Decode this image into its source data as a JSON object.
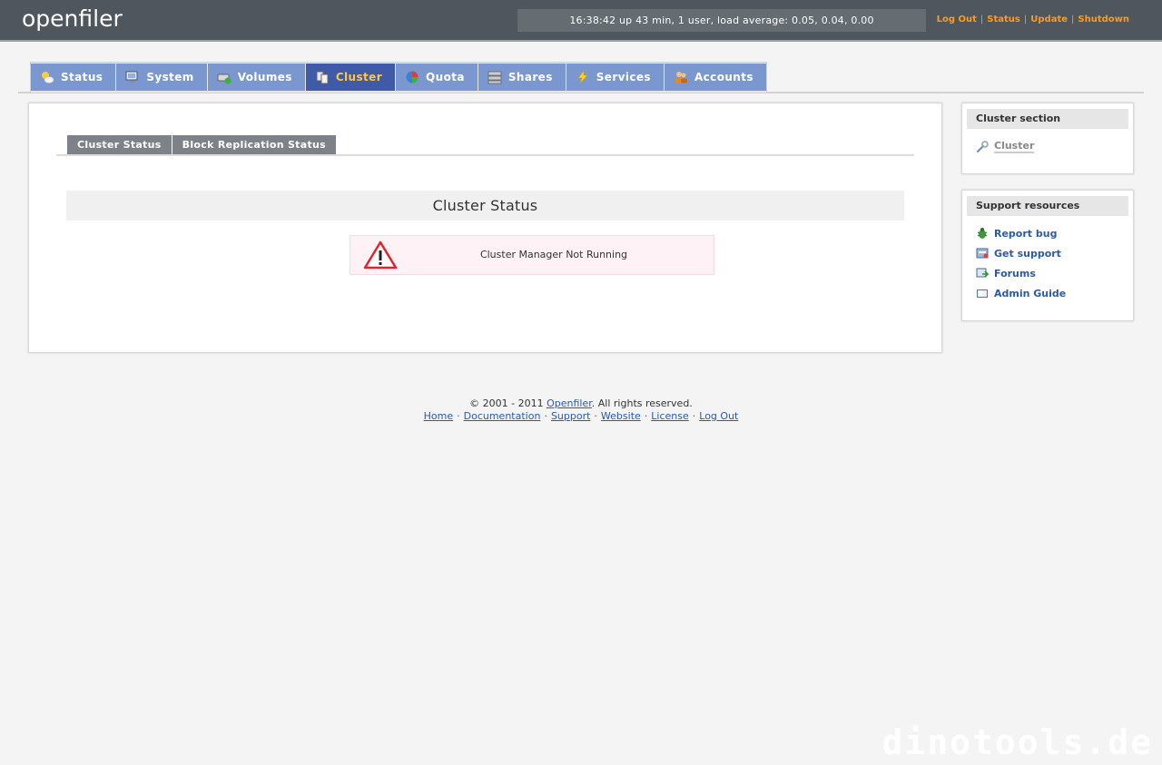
{
  "header": {
    "logo": "openfiler",
    "uptime": "16:38:42 up 43 min, 1 user, load average: 0.05, 0.04, 0.00",
    "links": [
      "Log Out",
      "Status",
      "Update",
      "Shutdown"
    ]
  },
  "tabs": [
    {
      "label": "Status",
      "icon": "weather-icon"
    },
    {
      "label": "System",
      "icon": "computer-icon"
    },
    {
      "label": "Volumes",
      "icon": "disk-icon"
    },
    {
      "label": "Cluster",
      "icon": "cluster-icon",
      "active": true
    },
    {
      "label": "Quota",
      "icon": "pie-icon"
    },
    {
      "label": "Shares",
      "icon": "server-icon"
    },
    {
      "label": "Services",
      "icon": "lightning-icon"
    },
    {
      "label": "Accounts",
      "icon": "users-icon"
    }
  ],
  "subtabs": [
    "Cluster Status",
    "Block Replication Status"
  ],
  "main": {
    "section_title": "Cluster Status",
    "alert_message": "Cluster Manager Not Running"
  },
  "sidebar": {
    "cluster_section": {
      "title": "Cluster section",
      "items": [
        {
          "label": "Cluster",
          "icon": "wrench-icon"
        }
      ]
    },
    "support": {
      "title": "Support resources",
      "items": [
        {
          "label": "Report bug",
          "icon": "bug-icon"
        },
        {
          "label": "Get support",
          "icon": "support-icon"
        },
        {
          "label": "Forums",
          "icon": "forums-icon"
        },
        {
          "label": "Admin Guide",
          "icon": "book-icon"
        }
      ]
    }
  },
  "footer": {
    "copyright_prefix": "© 2001 - 2011 ",
    "brand": "Openfiler",
    "copyright_suffix": ". All rights reserved.",
    "links": [
      "Home",
      "Documentation",
      "Support",
      "Website",
      "License",
      "Log Out"
    ]
  },
  "watermark": "dinotools.de",
  "colors": {
    "header_bg": "#4f565d",
    "top_link": "#ff9a1a",
    "tab": "#7b97d0",
    "tab_active": "#3f5aa8",
    "tab_active_text": "#ffc640",
    "link": "#2b5aa8"
  }
}
